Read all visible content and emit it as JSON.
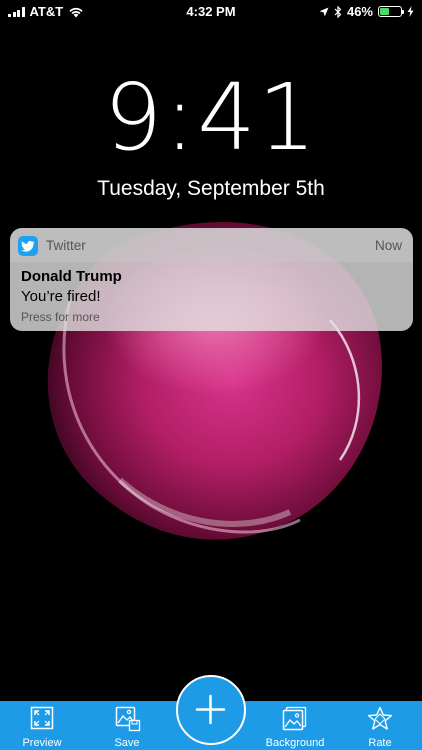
{
  "status_bar": {
    "carrier": "AT&T",
    "time": "4:32 PM",
    "battery_percent": "46%",
    "battery_level": 0.46,
    "battery_fill_color": "#4cd964",
    "icons": [
      "cellular-signal-icon",
      "wifi-icon",
      "location-arrow-icon",
      "bluetooth-icon",
      "battery-icon",
      "charging-bolt-icon"
    ]
  },
  "lock_screen": {
    "clock": "9:41",
    "date": "Tuesday, September 5th"
  },
  "notification": {
    "app_icon": "twitter-bird-icon",
    "app_name": "Twitter",
    "time": "Now",
    "title": "Donald Trump",
    "body": "You’re fired!",
    "hint": "Press for more"
  },
  "toolbar": {
    "color": "#1d9be6",
    "items": [
      {
        "label": "Preview",
        "icon": "preview-frame-icon"
      },
      {
        "label": "Save",
        "icon": "save-image-icon"
      },
      {
        "label": "Background",
        "icon": "background-image-icon"
      },
      {
        "label": "Rate",
        "icon": "rate-star-icon"
      }
    ],
    "add_icon": "plus-icon"
  }
}
